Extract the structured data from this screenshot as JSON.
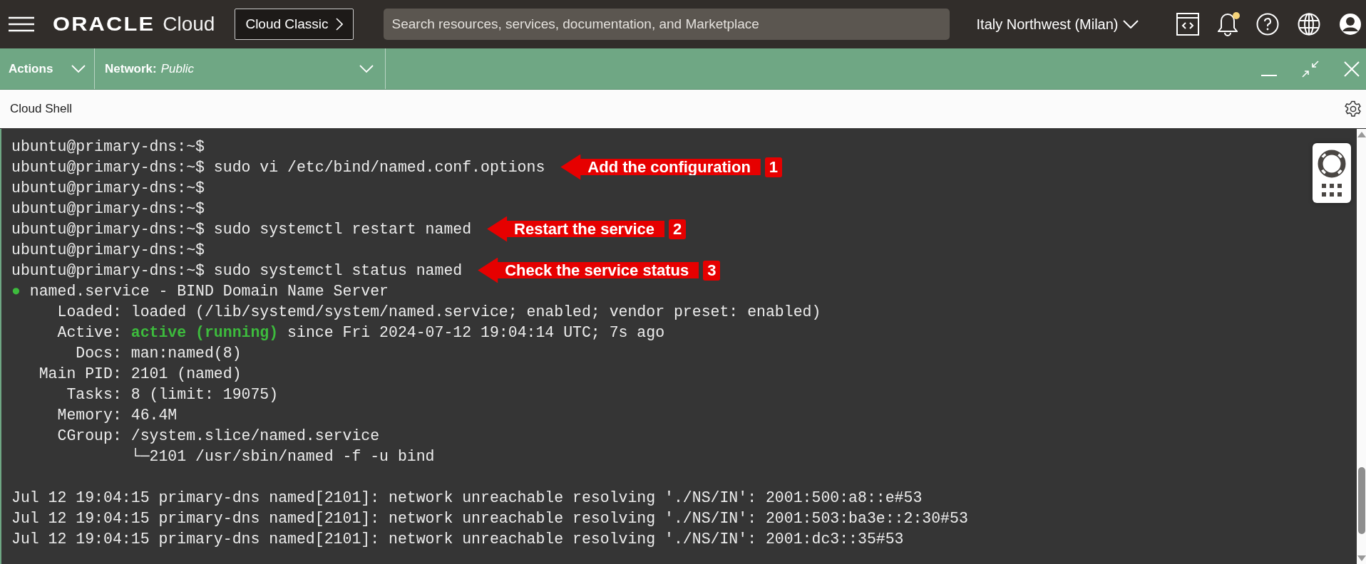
{
  "header": {
    "logo_brand": "ORACLE",
    "logo_product": "Cloud",
    "classic_button": "Cloud Classic",
    "search": {
      "placeholder": "Search resources, services, documentation, and Marketplace"
    },
    "region": "Italy Northwest (Milan)",
    "notification_dot": true
  },
  "shell_toolbar": {
    "actions": "Actions",
    "network_label": "Network:",
    "network_value": "Public"
  },
  "panel_title": "Cloud Shell",
  "terminal": {
    "lines": [
      {
        "kind": "text",
        "segments": [
          {
            "text": "ubuntu@primary-dns:~$",
            "kind": "plain"
          }
        ]
      },
      {
        "kind": "text",
        "segments": [
          {
            "text": "ubuntu@primary-dns:~$ sudo vi /etc/bind/named.conf.options",
            "kind": "plain"
          }
        ],
        "annotation": {
          "text": "Add the configuration",
          "number": "1"
        }
      },
      {
        "kind": "text",
        "segments": [
          {
            "text": "ubuntu@primary-dns:~$",
            "kind": "plain"
          }
        ]
      },
      {
        "kind": "text",
        "segments": [
          {
            "text": "ubuntu@primary-dns:~$",
            "kind": "plain"
          }
        ]
      },
      {
        "kind": "text",
        "segments": [
          {
            "text": "ubuntu@primary-dns:~$ sudo systemctl restart named",
            "kind": "plain"
          }
        ],
        "annotation": {
          "text": "Restart the service",
          "number": "2"
        }
      },
      {
        "kind": "text",
        "segments": [
          {
            "text": "ubuntu@primary-dns:~$",
            "kind": "plain"
          }
        ]
      },
      {
        "kind": "text",
        "segments": [
          {
            "text": "ubuntu@primary-dns:~$ sudo systemctl status named",
            "kind": "plain"
          }
        ],
        "annotation": {
          "text": "Check the service status",
          "number": "3"
        }
      },
      {
        "kind": "text",
        "segments": [
          {
            "text": "●",
            "kind": "ok"
          },
          {
            "text": " named.service - BIND Domain Name Server",
            "kind": "plain"
          }
        ]
      },
      {
        "kind": "text",
        "segments": [
          {
            "text": "     Loaded: loaded (/lib/systemd/system/named.service; enabled; vendor preset: enabled)",
            "kind": "plain"
          }
        ]
      },
      {
        "kind": "text",
        "segments": [
          {
            "text": "     Active: ",
            "kind": "plain"
          },
          {
            "text": "active (running)",
            "kind": "ok"
          },
          {
            "text": " since Fri 2024-07-12 19:04:14 UTC; 7s ago",
            "kind": "plain"
          }
        ]
      },
      {
        "kind": "text",
        "segments": [
          {
            "text": "       Docs: man:named(8)",
            "kind": "plain"
          }
        ]
      },
      {
        "kind": "text",
        "segments": [
          {
            "text": "   Main PID: 2101 (named)",
            "kind": "plain"
          }
        ]
      },
      {
        "kind": "text",
        "segments": [
          {
            "text": "      Tasks: 8 (limit: 19075)",
            "kind": "plain"
          }
        ]
      },
      {
        "kind": "text",
        "segments": [
          {
            "text": "     Memory: 46.4M",
            "kind": "plain"
          }
        ]
      },
      {
        "kind": "text",
        "segments": [
          {
            "text": "     CGroup: /system.slice/named.service",
            "kind": "plain"
          }
        ]
      },
      {
        "kind": "text",
        "segments": [
          {
            "text": "             └─2101 /usr/sbin/named -f -u bind",
            "kind": "plain"
          }
        ]
      },
      {
        "kind": "blank"
      },
      {
        "kind": "text",
        "segments": [
          {
            "text": "Jul 12 19:04:15 primary-dns named[2101]: network unreachable resolving './NS/IN': 2001:500:a8::e#53",
            "kind": "plain"
          }
        ]
      },
      {
        "kind": "text",
        "segments": [
          {
            "text": "Jul 12 19:04:15 primary-dns named[2101]: network unreachable resolving './NS/IN': 2001:503:ba3e::2:30#53",
            "kind": "plain"
          }
        ]
      },
      {
        "kind": "text",
        "segments": [
          {
            "text": "Jul 12 19:04:15 primary-dns named[2101]: network unreachable resolving './NS/IN': 2001:dc3::35#53",
            "kind": "plain"
          }
        ]
      }
    ]
  }
}
